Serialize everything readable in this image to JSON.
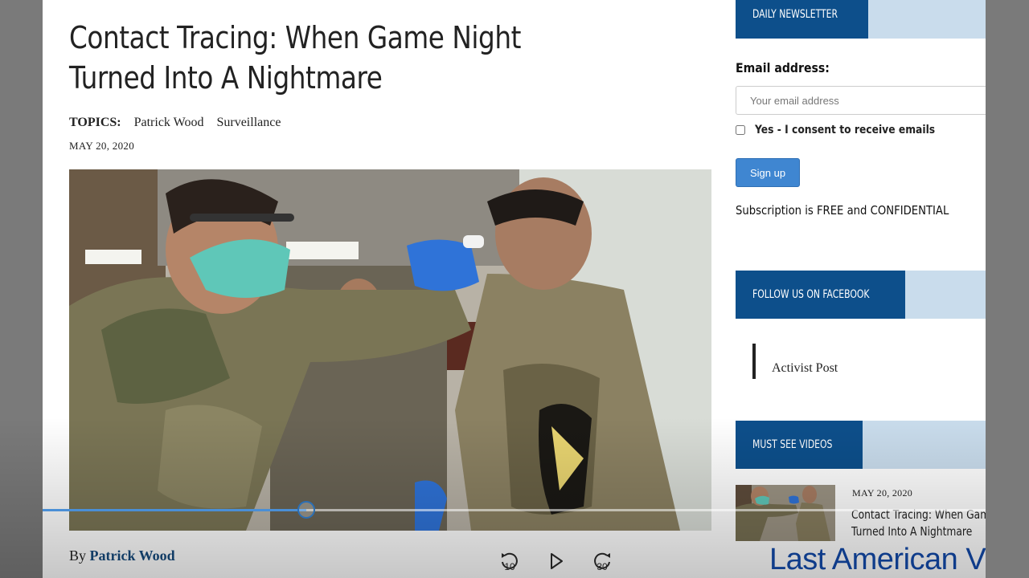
{
  "article": {
    "title": "Contact Tracing: When Game Night Turned Into A Nightmare",
    "topics_label": "TOPICS:",
    "topics": [
      "Patrick Wood",
      "Surveillance"
    ],
    "date": "MAY 20, 2020",
    "byline_prefix": "By",
    "author": "Patrick Wood"
  },
  "sidebar": {
    "newsletter_heading": "DAILY NEWSLETTER",
    "email_label": "Email address:",
    "email_placeholder": "Your email address",
    "email_value": "",
    "consent_label": "Yes - I consent to receive emails",
    "consent_checked": false,
    "signup_label": "Sign up",
    "subscription_note": "Subscription is FREE and CONFIDENTIAL",
    "facebook_heading": "FOLLOW US ON FACEBOOK",
    "facebook_page": "Activist Post",
    "videos_heading": "MUST SEE VIDEOS",
    "video_item": {
      "date": "MAY 20, 2020",
      "title_line1": "Contact Tracing: When Gam",
      "title_line2": "Turned Into A Nightmare"
    }
  },
  "player": {
    "progress": 0.28,
    "rewind_seconds": "10",
    "forward_seconds": "30",
    "watermark": "Last American V"
  },
  "colors": {
    "brand_blue": "#0d4f8b",
    "header_light": "#c9dcec",
    "link_blue": "#154a7d",
    "button_blue": "#3f86d1",
    "scrub_blue": "#4a8fd6"
  }
}
